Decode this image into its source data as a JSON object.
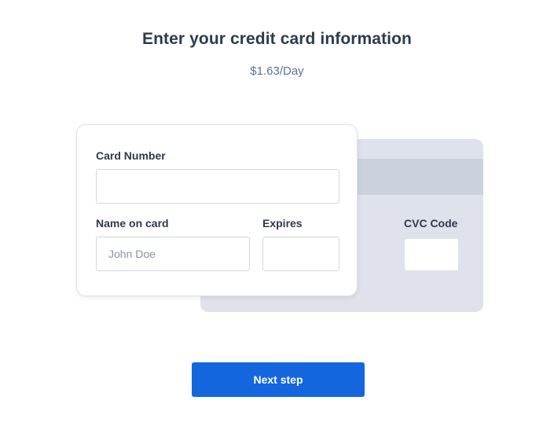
{
  "header": {
    "title": "Enter your credit card information",
    "price": "$1.63/Day"
  },
  "card_front": {
    "card_number_label": "Card Number",
    "card_number_value": "",
    "card_number_placeholder": "",
    "name_label": "Name on card",
    "name_value": "",
    "name_placeholder": "John Doe",
    "expires_label": "Expires",
    "expires_value": "",
    "expires_placeholder": ""
  },
  "card_back": {
    "cvc_label": "CVC Code",
    "cvc_value": "",
    "cvc_placeholder": ""
  },
  "actions": {
    "next_label": "Next step"
  },
  "colors": {
    "primary_button": "#1466de",
    "title_text": "#2d3b4d",
    "price_text": "#5a7394",
    "card_back": "#dfe2ea",
    "mag_stripe": "#cbd2dd"
  }
}
